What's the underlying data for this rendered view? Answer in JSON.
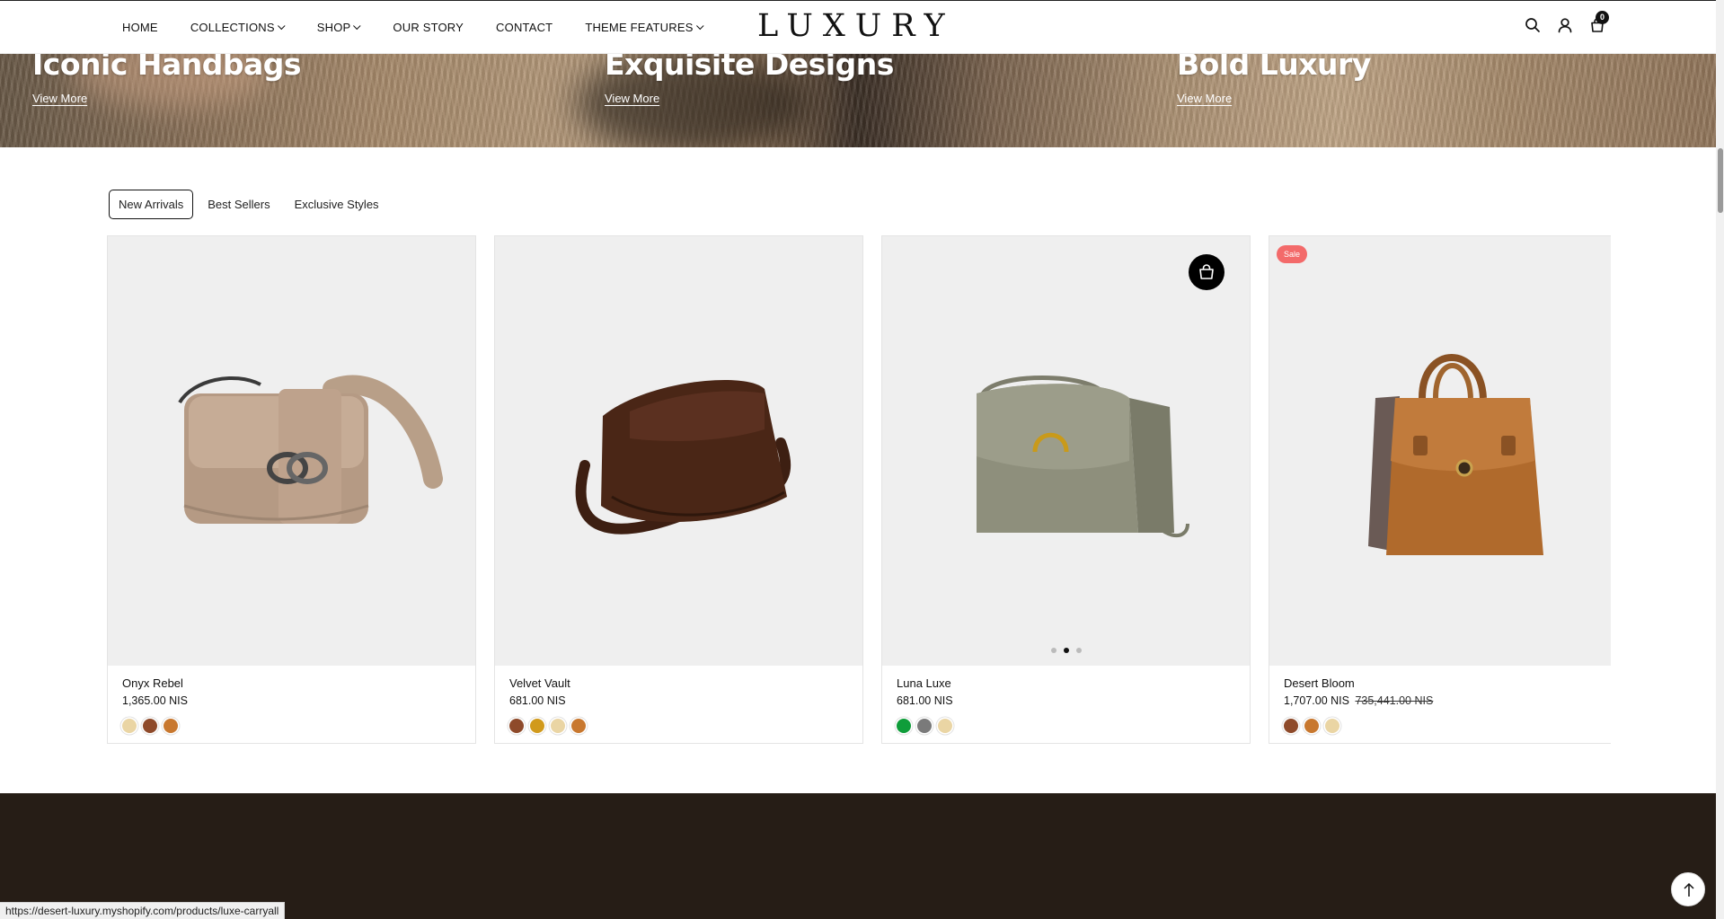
{
  "header": {
    "nav": [
      "HOME",
      "COLLECTIONS",
      "SHOP",
      "OUR STORY",
      "CONTACT",
      "THEME FEATURES"
    ],
    "logo": "LUXURY",
    "cart_count": "0",
    "icons": [
      "search-icon",
      "account-icon",
      "cart-icon"
    ]
  },
  "hero": {
    "items": [
      {
        "title": "Iconic Handbags",
        "link": "View More"
      },
      {
        "title": "Exquisite Designs",
        "link": "View More"
      },
      {
        "title": "Bold Luxury",
        "link": "View More"
      }
    ]
  },
  "tabs": {
    "items": [
      "New Arrivals",
      "Best Sellers",
      "Exclusive Styles"
    ],
    "active": "New Arrivals"
  },
  "products": [
    {
      "name": "Onyx Rebel",
      "price": "1,365.00 NIS",
      "compare_price": "",
      "swatches": [
        "#ead5a4",
        "#8e4a2a",
        "#c8782f"
      ]
    },
    {
      "name": "Velvet Vault",
      "price": "681.00 NIS",
      "compare_price": "",
      "swatches": [
        "#8e4a2a",
        "#d19a1c",
        "#ead5a4",
        "#c8782f"
      ]
    },
    {
      "name": "Luna Luxe",
      "price": "681.00 NIS",
      "compare_price": "",
      "swatches": [
        "#0f9d3a",
        "#7a7a7a",
        "#ead5a4"
      ]
    },
    {
      "name": "Desert Bloom",
      "price": "1,707.00 NIS",
      "compare_price": "735,441.00 NIS",
      "badge": "Sale",
      "swatches": [
        "#8e4a2a",
        "#c8782f",
        "#ead5a4"
      ]
    }
  ],
  "status_bar": "https://desert-luxury.myshopify.com/products/luxe-carryall",
  "colors": {
    "footer": "#261d16",
    "sale_badge": "#f36a6a",
    "tab_border": "#111111"
  }
}
